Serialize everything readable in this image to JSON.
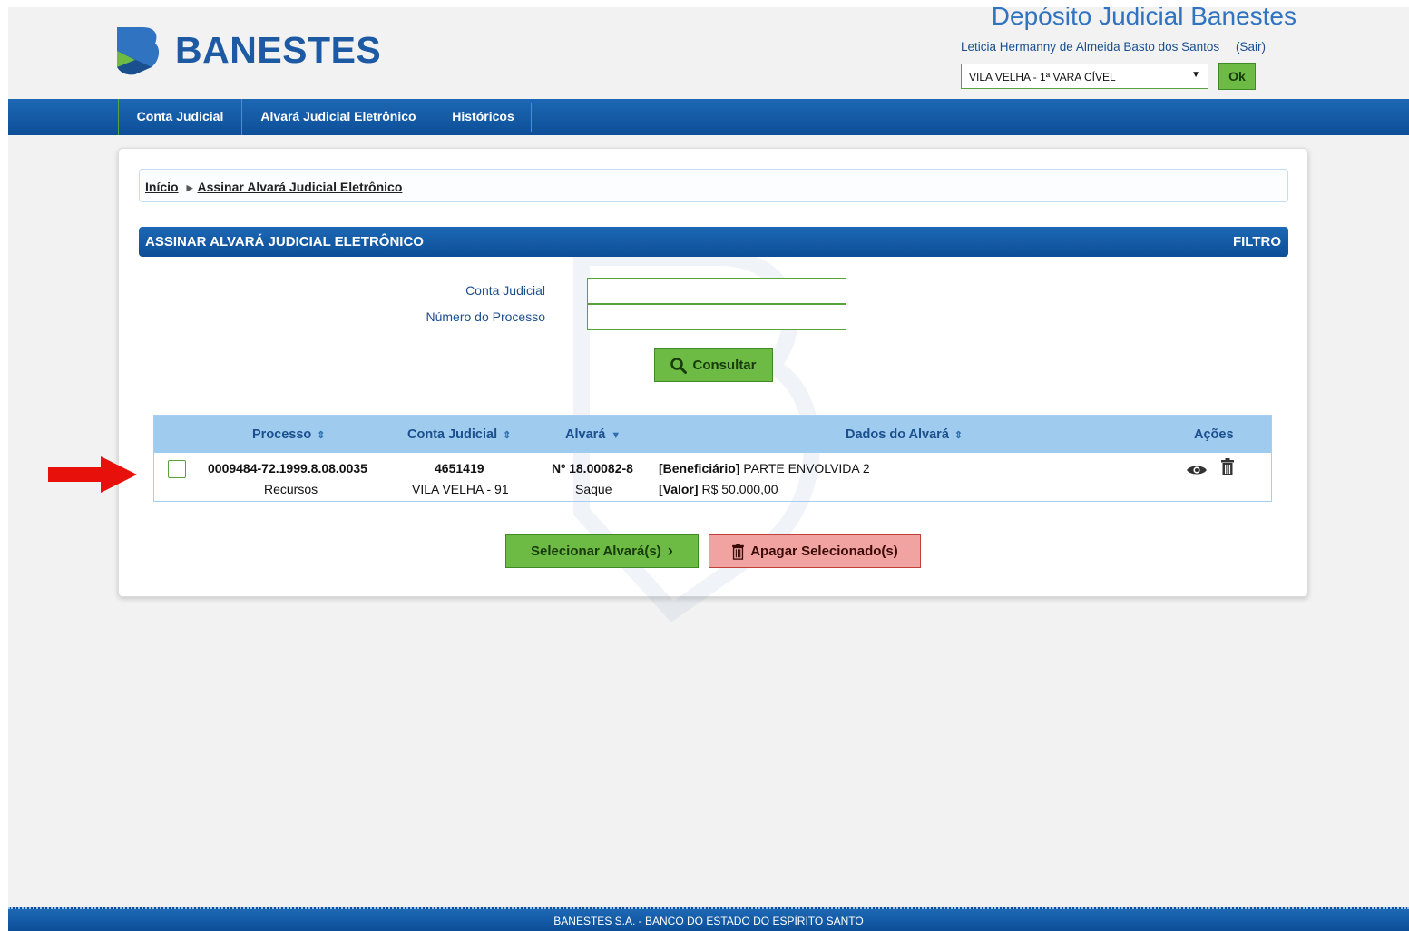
{
  "header": {
    "logo_text": "BANESTES",
    "site_title": "Depósito Judicial Banestes",
    "user_name": "Leticia Hermanny de Almeida Basto dos Santos",
    "logout_label": "(Sair)",
    "court_select_value": "VILA VELHA - 1ª VARA CÍVEL",
    "ok_label": "Ok"
  },
  "nav": {
    "items": [
      {
        "label": "Conta Judicial"
      },
      {
        "label": "Alvará Judicial Eletrônico"
      },
      {
        "label": "Históricos"
      }
    ]
  },
  "breadcrumb": {
    "home": "Início",
    "current": "Assinar Alvará Judicial Eletrônico"
  },
  "section": {
    "title": "ASSINAR ALVARÁ JUDICIAL ELETRÔNICO",
    "filter_label": "FILTRO"
  },
  "form": {
    "conta_label": "Conta Judicial",
    "conta_value": "",
    "processo_label": "Número do Processo",
    "processo_value": "",
    "consultar_label": "Consultar"
  },
  "table": {
    "columns": {
      "processo": "Processo",
      "conta": "Conta Judicial",
      "alvara": "Alvará",
      "dados": "Dados do Alvará",
      "acoes": "Ações"
    },
    "rows": [
      {
        "processo": "0009484-72.1999.8.08.0035",
        "processo_sub": "Recursos",
        "conta": "4651419",
        "conta_sub": "VILA VELHA - 91",
        "alvara": "Nº 18.00082-8",
        "alvara_sub": "Saque",
        "beneficiario_label": "[Beneficiário]",
        "beneficiario_value": "PARTE ENVOLVIDA 2",
        "valor_label": "[Valor]",
        "valor_value": "R$ 50.000,00",
        "checked": false
      }
    ]
  },
  "actions": {
    "select_label": "Selecionar Alvará(s)",
    "delete_label": "Apagar Selecionado(s)"
  },
  "footer": {
    "text": "BANESTES S.A. - BANCO DO ESTADO DO ESPÍRITO SANTO"
  },
  "colors": {
    "brand_blue": "#1d5aa3",
    "nav_blue": "#0d4e98",
    "accent_green": "#6dbb45",
    "danger_red": "#f0a3a0",
    "table_header": "#9fcbef"
  }
}
